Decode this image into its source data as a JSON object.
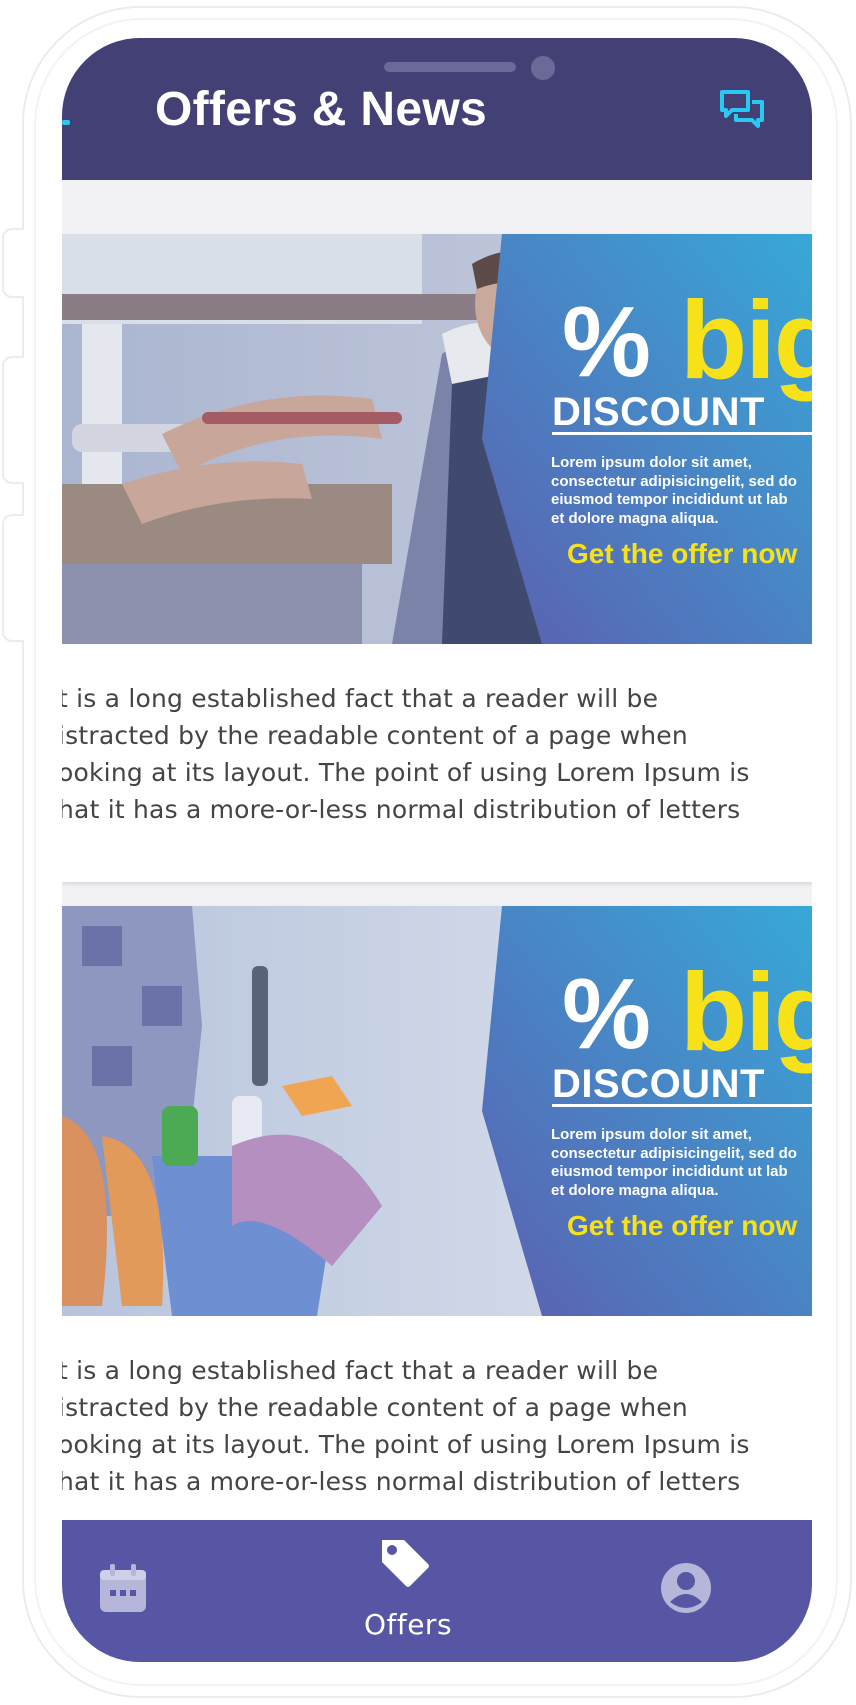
{
  "header": {
    "title": "Offers & News",
    "chat_icon": "chat-bubbles-icon",
    "accent_color": "#29c9f1",
    "background_color": "#434076"
  },
  "offers": [
    {
      "image": "plumber-fixing-sink-pipe",
      "banner": {
        "percent": "%",
        "big": "big",
        "discount": "DISCOUNT",
        "body_lines": [
          "Lorem ipsum dolor sit amet,",
          "consectetur adipisicingelit, sed do",
          "eiusmod tempor incididunt ut lab",
          "et dolore magna aliqua."
        ],
        "cta": "Get the offer now"
      },
      "description_lines": [
        "t is a long established fact that a reader will be",
        "istracted by the readable content of a page when",
        "ooking at its layout. The point of using Lorem Ipsum is",
        "hat it has a more-or-less normal distribution of letters"
      ]
    },
    {
      "image": "cleaner-holding-bucket-of-supplies",
      "banner": {
        "percent": "%",
        "big": "big",
        "discount": "DISCOUNT",
        "body_lines": [
          "Lorem ipsum dolor sit amet,",
          "consectetur adipisicingelit, sed do",
          "eiusmod tempor incididunt ut lab",
          "et dolore magna aliqua."
        ],
        "cta": "Get the offer now"
      },
      "description_lines": [
        "t is a long established fact that a reader will be",
        "istracted by the readable content of a page when",
        "ooking at its layout. The point of using Lorem Ipsum is",
        "hat it has a more-or-less normal distribution of letters"
      ]
    }
  ],
  "bottom_nav": {
    "background_color": "#5656a4",
    "items": [
      {
        "icon": "calendar-icon",
        "label": ""
      },
      {
        "icon": "tag-icon",
        "label": "Offers"
      },
      {
        "icon": "profile-icon",
        "label": ""
      }
    ]
  }
}
